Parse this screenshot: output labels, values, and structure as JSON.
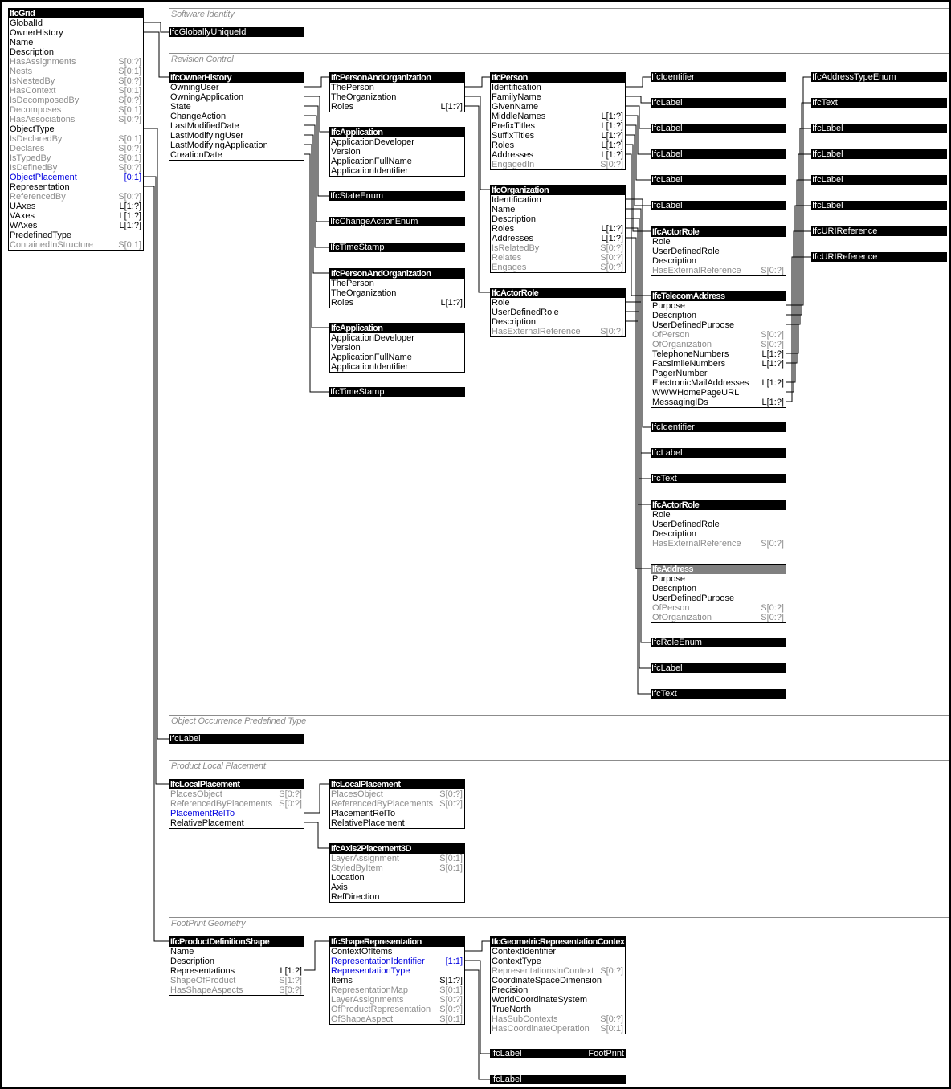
{
  "sections": [
    {
      "id": "s-software",
      "title": "Software Identity"
    },
    {
      "id": "s-revision",
      "title": "Revision Control"
    },
    {
      "id": "s-predef",
      "title": "Object Occurrence Predefined Type"
    },
    {
      "id": "s-placement",
      "title": "Product Local Placement"
    },
    {
      "id": "s-footprint",
      "title": "FootPrint Geometry"
    }
  ],
  "entities": [
    {
      "id": "grid",
      "name": "IfcGrid",
      "attrs": [
        {
          "n": "GlobalId"
        },
        {
          "n": "OwnerHistory"
        },
        {
          "n": "Name"
        },
        {
          "n": "Description"
        },
        {
          "n": "HasAssignments",
          "c": "S[0:?]",
          "k": "inverse"
        },
        {
          "n": "Nests",
          "c": "S[0:1]",
          "k": "inverse"
        },
        {
          "n": "IsNestedBy",
          "c": "S[0:?]",
          "k": "inverse"
        },
        {
          "n": "HasContext",
          "c": "S[0:1]",
          "k": "inverse"
        },
        {
          "n": "IsDecomposedBy",
          "c": "S[0:?]",
          "k": "inverse"
        },
        {
          "n": "Decomposes",
          "c": "S[0:1]",
          "k": "inverse"
        },
        {
          "n": "HasAssociations",
          "c": "S[0:?]",
          "k": "inverse"
        },
        {
          "n": "ObjectType"
        },
        {
          "n": "IsDeclaredBy",
          "c": "S[0:1]",
          "k": "inverse"
        },
        {
          "n": "Declares",
          "c": "S[0:?]",
          "k": "inverse"
        },
        {
          "n": "IsTypedBy",
          "c": "S[0:1]",
          "k": "inverse"
        },
        {
          "n": "IsDefinedBy",
          "c": "S[0:?]",
          "k": "inverse"
        },
        {
          "n": "ObjectPlacement",
          "c": "[0:1]",
          "k": "highlight"
        },
        {
          "n": "Representation"
        },
        {
          "n": "ReferencedBy",
          "c": "S[0:?]",
          "k": "inverse"
        },
        {
          "n": "UAxes",
          "c": "L[1:?]"
        },
        {
          "n": "VAxes",
          "c": "L[1:?]"
        },
        {
          "n": "WAxes",
          "c": "L[1:?]"
        },
        {
          "n": "PredefinedType"
        },
        {
          "n": "ContainedInStructure",
          "c": "S[0:1]",
          "k": "inverse"
        }
      ]
    },
    {
      "id": "ownerhistory",
      "name": "IfcOwnerHistory",
      "attrs": [
        {
          "n": "OwningUser"
        },
        {
          "n": "OwningApplication"
        },
        {
          "n": "State"
        },
        {
          "n": "ChangeAction"
        },
        {
          "n": "LastModifiedDate"
        },
        {
          "n": "LastModifyingUser"
        },
        {
          "n": "LastModifyingApplication"
        },
        {
          "n": "CreationDate"
        }
      ]
    },
    {
      "id": "pao1",
      "name": "IfcPersonAndOrganization",
      "attrs": [
        {
          "n": "ThePerson"
        },
        {
          "n": "TheOrganization"
        },
        {
          "n": "Roles",
          "c": "L[1:?]"
        }
      ]
    },
    {
      "id": "app1",
      "name": "IfcApplication",
      "attrs": [
        {
          "n": "ApplicationDeveloper"
        },
        {
          "n": "Version"
        },
        {
          "n": "ApplicationFullName"
        },
        {
          "n": "ApplicationIdentifier"
        }
      ]
    },
    {
      "id": "pao2",
      "name": "IfcPersonAndOrganization",
      "attrs": [
        {
          "n": "ThePerson"
        },
        {
          "n": "TheOrganization"
        },
        {
          "n": "Roles",
          "c": "L[1:?]"
        }
      ]
    },
    {
      "id": "app2",
      "name": "IfcApplication",
      "attrs": [
        {
          "n": "ApplicationDeveloper"
        },
        {
          "n": "Version"
        },
        {
          "n": "ApplicationFullName"
        },
        {
          "n": "ApplicationIdentifier"
        }
      ]
    },
    {
      "id": "person",
      "name": "IfcPerson",
      "attrs": [
        {
          "n": "Identification"
        },
        {
          "n": "FamilyName"
        },
        {
          "n": "GivenName"
        },
        {
          "n": "MiddleNames",
          "c": "L[1:?]"
        },
        {
          "n": "PrefixTitles",
          "c": "L[1:?]"
        },
        {
          "n": "SuffixTitles",
          "c": "L[1:?]"
        },
        {
          "n": "Roles",
          "c": "L[1:?]"
        },
        {
          "n": "Addresses",
          "c": "L[1:?]"
        },
        {
          "n": "EngagedIn",
          "c": "S[0:?]",
          "k": "inverse"
        }
      ]
    },
    {
      "id": "org",
      "name": "IfcOrganization",
      "attrs": [
        {
          "n": "Identification"
        },
        {
          "n": "Name"
        },
        {
          "n": "Description"
        },
        {
          "n": "Roles",
          "c": "L[1:?]"
        },
        {
          "n": "Addresses",
          "c": "L[1:?]"
        },
        {
          "n": "IsRelatedBy",
          "c": "S[0:?]",
          "k": "inverse"
        },
        {
          "n": "Relates",
          "c": "S[0:?]",
          "k": "inverse"
        },
        {
          "n": "Engages",
          "c": "S[0:?]",
          "k": "inverse"
        }
      ]
    },
    {
      "id": "actorrole1",
      "name": "IfcActorRole",
      "attrs": [
        {
          "n": "Role"
        },
        {
          "n": "UserDefinedRole"
        },
        {
          "n": "Description"
        },
        {
          "n": "HasExternalReference",
          "c": "S[0:?]",
          "k": "inverse"
        }
      ]
    },
    {
      "id": "actorrole2",
      "name": "IfcActorRole",
      "attrs": [
        {
          "n": "Role"
        },
        {
          "n": "UserDefinedRole"
        },
        {
          "n": "Description"
        },
        {
          "n": "HasExternalReference",
          "c": "S[0:?]",
          "k": "inverse"
        }
      ]
    },
    {
      "id": "telecom",
      "name": "IfcTelecomAddress",
      "attrs": [
        {
          "n": "Purpose"
        },
        {
          "n": "Description"
        },
        {
          "n": "UserDefinedPurpose"
        },
        {
          "n": "OfPerson",
          "c": "S[0:?]",
          "k": "inverse"
        },
        {
          "n": "OfOrganization",
          "c": "S[0:?]",
          "k": "inverse"
        },
        {
          "n": "TelephoneNumbers",
          "c": "L[1:?]"
        },
        {
          "n": "FacsimileNumbers",
          "c": "L[1:?]"
        },
        {
          "n": "PagerNumber"
        },
        {
          "n": "ElectronicMailAddresses",
          "c": "L[1:?]"
        },
        {
          "n": "WWWHomePageURL"
        },
        {
          "n": "MessagingIDs",
          "c": "L[1:?]"
        }
      ]
    },
    {
      "id": "actorrole3",
      "name": "IfcActorRole",
      "attrs": [
        {
          "n": "Role"
        },
        {
          "n": "UserDefinedRole"
        },
        {
          "n": "Description"
        },
        {
          "n": "HasExternalReference",
          "c": "S[0:?]",
          "k": "inverse"
        }
      ]
    },
    {
      "id": "address",
      "name": "IfcAddress",
      "abstract": true,
      "attrs": [
        {
          "n": "Purpose"
        },
        {
          "n": "Description"
        },
        {
          "n": "UserDefinedPurpose"
        },
        {
          "n": "OfPerson",
          "c": "S[0:?]",
          "k": "inverse"
        },
        {
          "n": "OfOrganization",
          "c": "S[0:?]",
          "k": "inverse"
        }
      ]
    },
    {
      "id": "localplacement1",
      "name": "IfcLocalPlacement",
      "attrs": [
        {
          "n": "PlacesObject",
          "c": "S[0:?]",
          "k": "inverse"
        },
        {
          "n": "ReferencedByPlacements",
          "c": "S[0:?]",
          "k": "inverse"
        },
        {
          "n": "PlacementRelTo",
          "k": "highlight"
        },
        {
          "n": "RelativePlacement"
        }
      ]
    },
    {
      "id": "localplacement2",
      "name": "IfcLocalPlacement",
      "attrs": [
        {
          "n": "PlacesObject",
          "c": "S[0:?]",
          "k": "inverse"
        },
        {
          "n": "ReferencedByPlacements",
          "c": "S[0:?]",
          "k": "inverse"
        },
        {
          "n": "PlacementRelTo"
        },
        {
          "n": "RelativePlacement"
        }
      ]
    },
    {
      "id": "axis2placement",
      "name": "IfcAxis2Placement3D",
      "attrs": [
        {
          "n": "LayerAssignment",
          "c": "S[0:1]",
          "k": "inverse"
        },
        {
          "n": "StyledByItem",
          "c": "S[0:1]",
          "k": "inverse"
        },
        {
          "n": "Location"
        },
        {
          "n": "Axis"
        },
        {
          "n": "RefDirection"
        }
      ]
    },
    {
      "id": "pds",
      "name": "IfcProductDefinitionShape",
      "attrs": [
        {
          "n": "Name"
        },
        {
          "n": "Description"
        },
        {
          "n": "Representations",
          "c": "L[1:?]"
        },
        {
          "n": "ShapeOfProduct",
          "c": "S[1:?]",
          "k": "inverse"
        },
        {
          "n": "HasShapeAspects",
          "c": "S[0:?]",
          "k": "inverse"
        }
      ]
    },
    {
      "id": "shaperep",
      "name": "IfcShapeRepresentation",
      "attrs": [
        {
          "n": "ContextOfItems"
        },
        {
          "n": "RepresentationIdentifier",
          "c": "[1:1]",
          "k": "highlight"
        },
        {
          "n": "RepresentationType",
          "k": "highlight"
        },
        {
          "n": "Items",
          "c": "S[1:?]"
        },
        {
          "n": "RepresentationMap",
          "c": "S[0:1]",
          "k": "inverse"
        },
        {
          "n": "LayerAssignments",
          "c": "S[0:?]",
          "k": "inverse"
        },
        {
          "n": "OfProductRepresentation",
          "c": "S[0:?]",
          "k": "inverse"
        },
        {
          "n": "OfShapeAspect",
          "c": "S[0:1]",
          "k": "inverse"
        }
      ]
    },
    {
      "id": "geomctx",
      "name": "IfcGeometricRepresentationContext",
      "attrs": [
        {
          "n": "ContextIdentifier"
        },
        {
          "n": "ContextType"
        },
        {
          "n": "RepresentationsInContext",
          "c": "S[0:?]",
          "k": "inverse"
        },
        {
          "n": "CoordinateSpaceDimension"
        },
        {
          "n": "Precision"
        },
        {
          "n": "WorldCoordinateSystem"
        },
        {
          "n": "TrueNorth"
        },
        {
          "n": "HasSubContexts",
          "c": "S[0:?]",
          "k": "inverse"
        },
        {
          "n": "HasCoordinateOperation",
          "c": "S[0:1]",
          "k": "inverse"
        }
      ]
    }
  ],
  "types": [
    {
      "id": "t-guid",
      "name": "IfcGloballyUniqueId"
    },
    {
      "id": "t-stateenum",
      "name": "IfcStateEnum"
    },
    {
      "id": "t-changeenum",
      "name": "IfcChangeActionEnum"
    },
    {
      "id": "t-timestamp1",
      "name": "IfcTimeStamp"
    },
    {
      "id": "t-timestamp2",
      "name": "IfcTimeStamp"
    },
    {
      "id": "t-pid",
      "name": "IfcIdentifier"
    },
    {
      "id": "t-plabel1",
      "name": "IfcLabel"
    },
    {
      "id": "t-plabel2",
      "name": "IfcLabel"
    },
    {
      "id": "t-plabel3",
      "name": "IfcLabel"
    },
    {
      "id": "t-plabel4",
      "name": "IfcLabel"
    },
    {
      "id": "t-plabel5",
      "name": "IfcLabel"
    },
    {
      "id": "t-oid",
      "name": "IfcIdentifier"
    },
    {
      "id": "t-olabel",
      "name": "IfcLabel"
    },
    {
      "id": "t-otext",
      "name": "IfcText"
    },
    {
      "id": "t-roleenum",
      "name": "IfcRoleEnum"
    },
    {
      "id": "t-rlabel",
      "name": "IfcLabel"
    },
    {
      "id": "t-rtext",
      "name": "IfcText"
    },
    {
      "id": "t-addrtype",
      "name": "IfcAddressTypeEnum"
    },
    {
      "id": "t-ttext",
      "name": "IfcText"
    },
    {
      "id": "t-tlabel1",
      "name": "IfcLabel"
    },
    {
      "id": "t-tlabel2",
      "name": "IfcLabel"
    },
    {
      "id": "t-tlabel3",
      "name": "IfcLabel"
    },
    {
      "id": "t-tlabel4",
      "name": "IfcLabel"
    },
    {
      "id": "t-uri1",
      "name": "IfcURIReference"
    },
    {
      "id": "t-uri2",
      "name": "IfcURIReference"
    },
    {
      "id": "t-objtype",
      "name": "IfcLabel"
    },
    {
      "id": "t-repid",
      "name": "IfcLabel",
      "value": "FootPrint"
    },
    {
      "id": "t-reptype",
      "name": "IfcLabel"
    }
  ]
}
